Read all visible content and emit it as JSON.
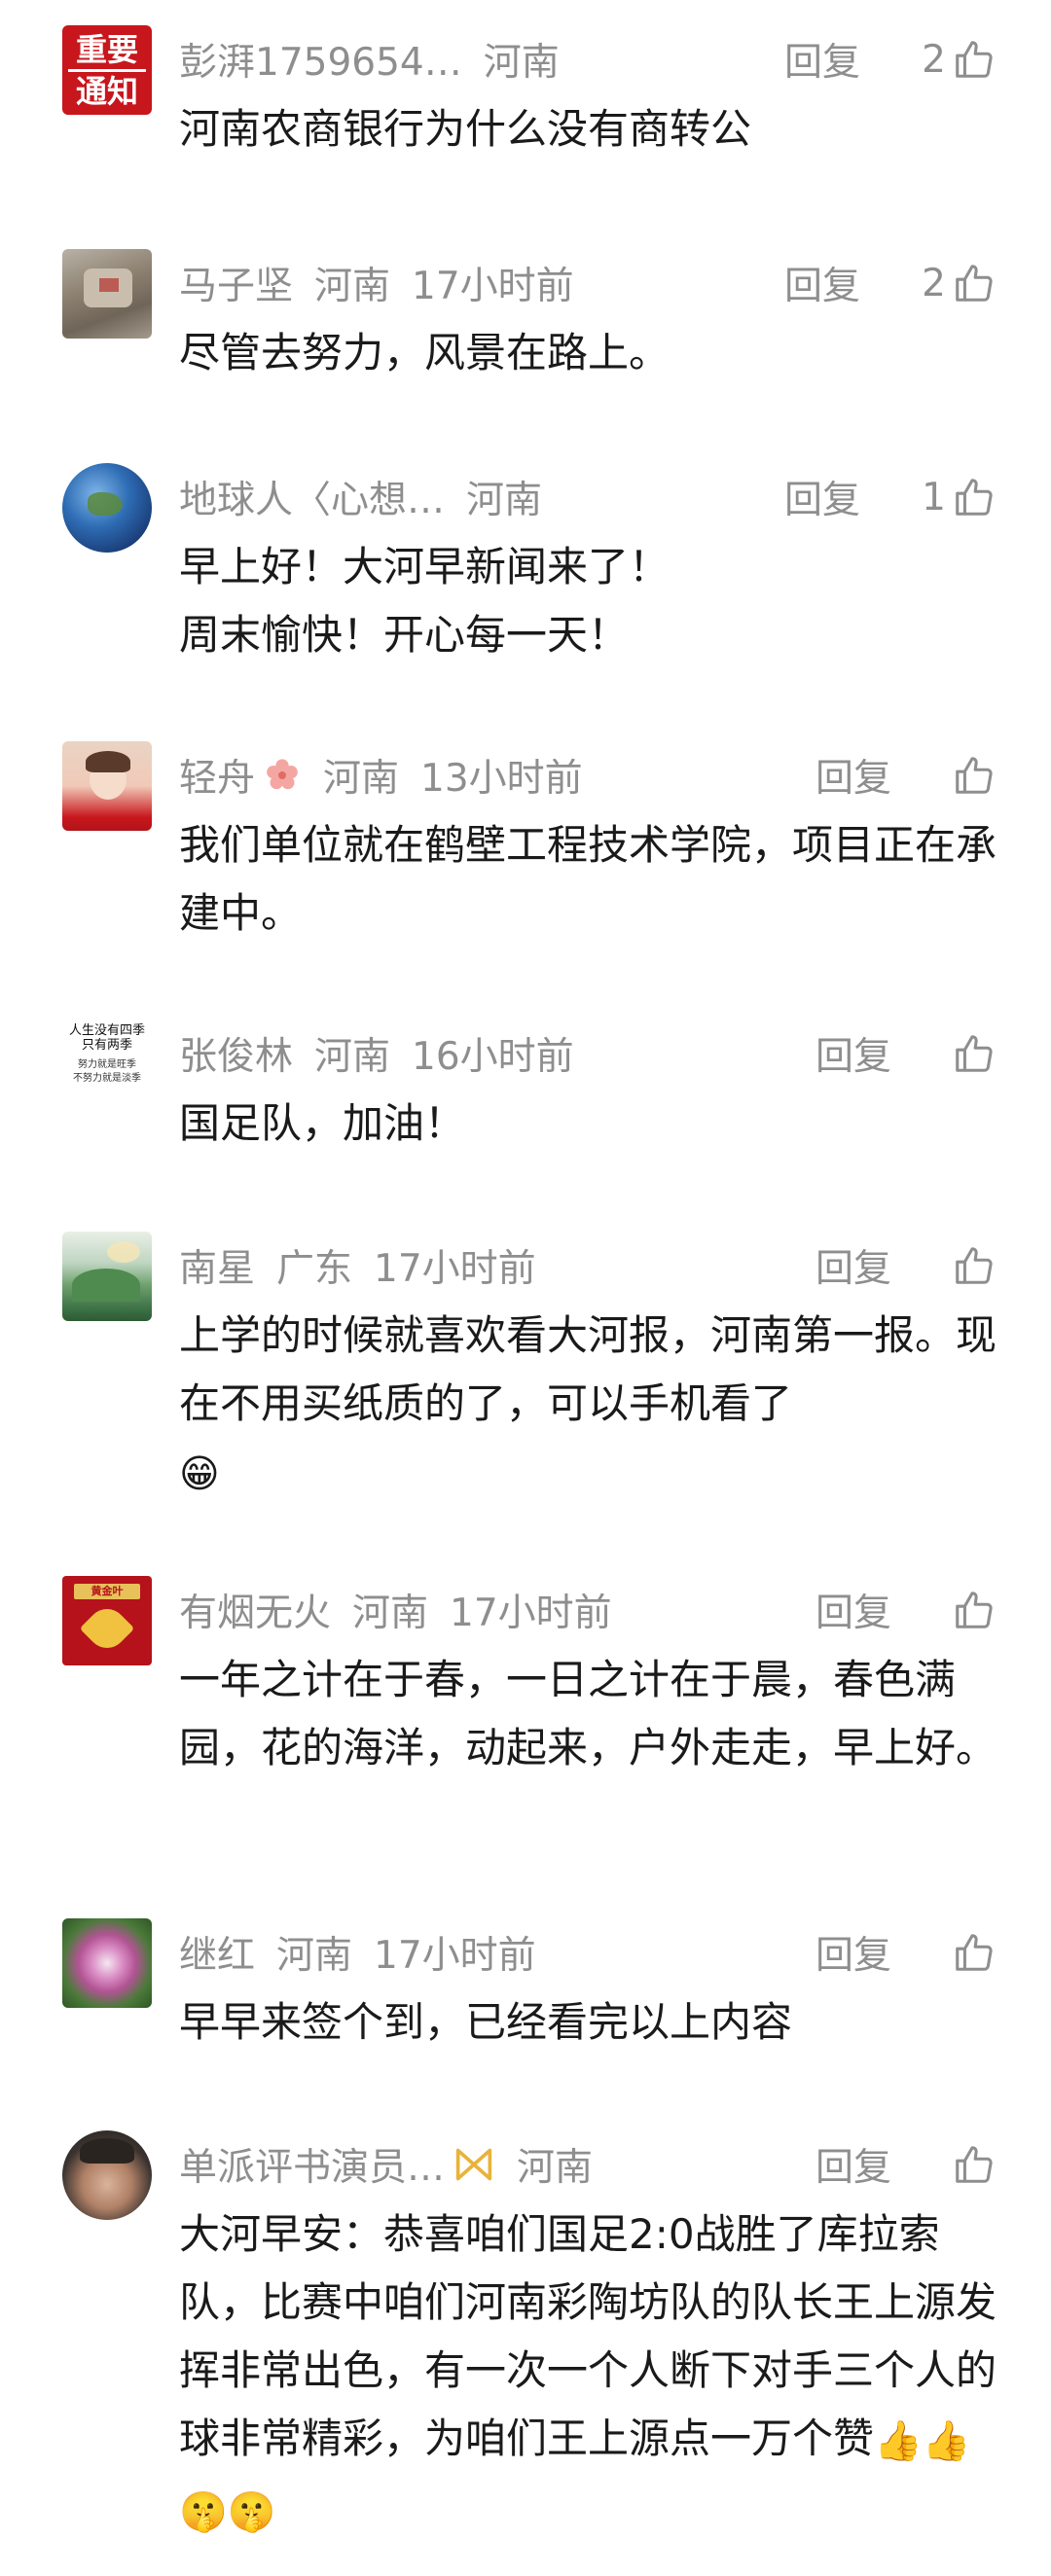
{
  "comments": [
    {
      "name": "彭湃1759654…",
      "location": "河南",
      "time": "",
      "reply": "回复",
      "likes": "2",
      "text": "河南农商银行为什么没有商转公",
      "avatar_text": [
        "重要",
        "通知"
      ],
      "emojis": ""
    },
    {
      "name": "马子坚",
      "location": "河南",
      "time": "17小时前",
      "reply": "回复",
      "likes": "2",
      "text": "尽管去努力，风景在路上。",
      "emojis": ""
    },
    {
      "name": "地球人〈心想…",
      "location": "河南",
      "time": "",
      "reply": "回复",
      "likes": "1",
      "text": "早上好！大河早新闻来了！\n周末愉快！开心每一天！",
      "emojis": ""
    },
    {
      "name": "轻舟",
      "location": "河南",
      "time": "13小时前",
      "reply": "回复",
      "likes": "",
      "text": "我们单位就在鹤壁工程技术学院，项目正在承建中。",
      "emojis": ""
    },
    {
      "name": "张俊林",
      "location": "河南",
      "time": "16小时前",
      "reply": "回复",
      "likes": "",
      "text": "国足队，加油！",
      "avatar_text": [
        "人生没有四季",
        "只有两季",
        "努力就是旺季",
        "不努力就是淡季"
      ],
      "emojis": ""
    },
    {
      "name": "南星",
      "location": "广东",
      "time": "17小时前",
      "reply": "回复",
      "likes": "",
      "text": "上学的时候就喜欢看大河报，河南第一报。现在不用买纸质的了，可以手机看了",
      "emojis": "😁"
    },
    {
      "name": "有烟无火",
      "location": "河南",
      "time": "17小时前",
      "reply": "回复",
      "likes": "",
      "text": "一年之计在于春，一日之计在于晨，春色满园，花的海洋，动起来，户外走走，早上好。",
      "avatar_text": [
        "黄金叶"
      ],
      "emojis": ""
    },
    {
      "name": "继红",
      "location": "河南",
      "time": "17小时前",
      "reply": "回复",
      "likes": "",
      "text": "早早来签个到，已经看完以上内容",
      "emojis": ""
    },
    {
      "name": "单派评书演员…",
      "location": "河南",
      "time": "",
      "reply": "回复",
      "likes": "",
      "text": "大河早安：恭喜咱们国足2:0战胜了库拉索队，比赛中咱们河南彩陶坊队的队长王上源发挥非常出色，有一次一个人断下对手三个人的球非常精彩，为咱们王上源点一万个赞",
      "emojis": "👍👍🤫🤫"
    }
  ],
  "colors": {
    "meta": "#8e8e8e",
    "text": "#1a1a1a",
    "avatar_badge": "#c8161d",
    "badge": "#e8b33a"
  },
  "icons": {
    "like": "thumbs-up-icon",
    "badge": "bow-badge-icon"
  }
}
